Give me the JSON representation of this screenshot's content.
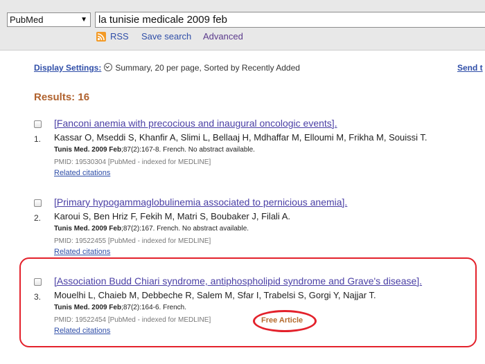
{
  "search": {
    "database": "PubMed",
    "query": "la tunisie medicale 2009 feb",
    "rss_label": "RSS",
    "save_search_label": "Save search",
    "advanced_label": "Advanced"
  },
  "display": {
    "label": "Display Settings:",
    "value": "Summary, 20 per page, Sorted by Recently Added",
    "send_to": "Send t"
  },
  "results_label": "Results: 16",
  "results": [
    {
      "number": "1.",
      "title": "[Fanconi anemia with precocious and inaugural oncologic events].",
      "authors": "Kassar O, Mseddi S, Khanfir A, Slimi L, Bellaaj H, Mdhaffar M, Elloumi M, Frikha M, Souissi T.",
      "journal": "Tunis Med. 2009 Feb",
      "citation_rest": ";87(2):167-8. French. No abstract available.",
      "pmid": "PMID: 19530304 [PubMed - indexed for MEDLINE]",
      "related": "Related citations"
    },
    {
      "number": "2.",
      "title": "[Primary hypogammaglobulinemia associated to pernicious anemia].",
      "authors": "Karoui S, Ben Hriz F, Fekih M, Matri S, Boubaker J, Filali A.",
      "journal": "Tunis Med. 2009 Feb",
      "citation_rest": ";87(2):167. French. No abstract available.",
      "pmid": "PMID: 19522455 [PubMed - indexed for MEDLINE]",
      "related": "Related citations"
    },
    {
      "number": "3.",
      "title": "[Association Budd Chiari syndrome, antiphospholipid syndrome and Grave's disease].",
      "authors": "Mouelhi L, Chaieb M, Debbeche R, Salem M, Sfar I, Trabelsi S, Gorgi Y, Najjar T.",
      "journal": "Tunis Med. 2009 Feb",
      "citation_rest": ";87(2):164-6. French.",
      "pmid": "PMID: 19522454 [PubMed - indexed for MEDLINE]",
      "related": "Related citations",
      "free_article": "Free Article"
    }
  ],
  "colors": {
    "annotation": "#e3212b",
    "link": "#2f4ea8",
    "title_link": "#4a3fa5",
    "results_heading": "#b0622e"
  }
}
